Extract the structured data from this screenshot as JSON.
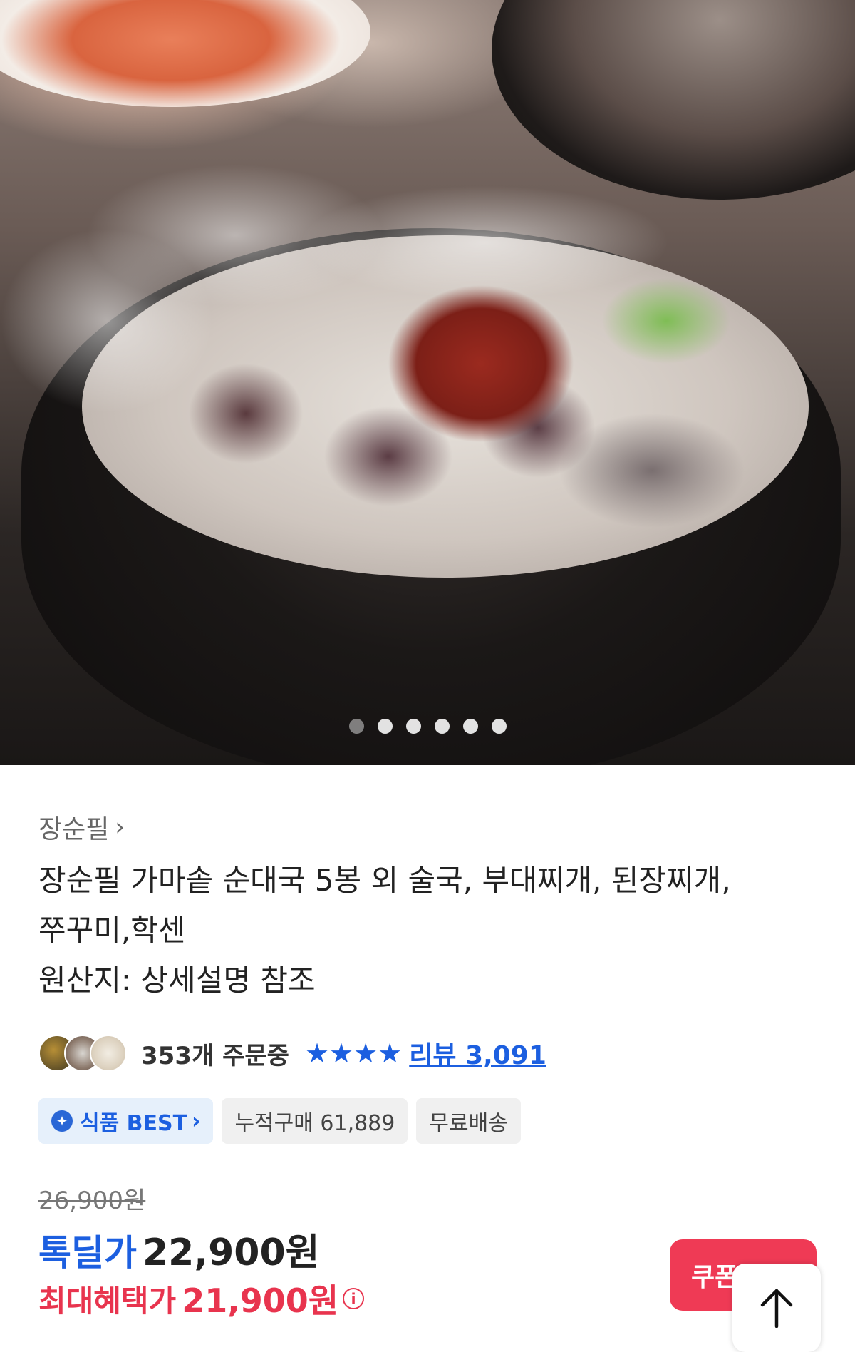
{
  "hero": {
    "image": "sundae-gukbap-in-stone-pot",
    "carousel": {
      "count": 6,
      "active": 0
    }
  },
  "product": {
    "brand": "장순필",
    "title_lines": [
      "장순필 가마솥 순대국 5봉 외 술국, 부대찌개, 된장찌개,",
      "쭈꾸미,학센",
      "원산지: 상세설명 참조"
    ]
  },
  "social": {
    "orders": "353개 주문중",
    "rating_stars": 4,
    "review_text": "리뷰 3,091"
  },
  "badges": {
    "best": "식품 BEST",
    "cumulative": "누적구매 61,889",
    "shipping": "무료배송"
  },
  "price": {
    "original": "26,900원",
    "deal_label": "톡딜가",
    "deal_price": "22,900원",
    "max_label": "최대혜택가",
    "max_price": "21,900원"
  },
  "buttons": {
    "coupon": "쿠폰 받기"
  },
  "colors": {
    "accent_blue": "#1c5fe0",
    "accent_red": "#e8344e",
    "coupon_red": "#ef3a55"
  }
}
